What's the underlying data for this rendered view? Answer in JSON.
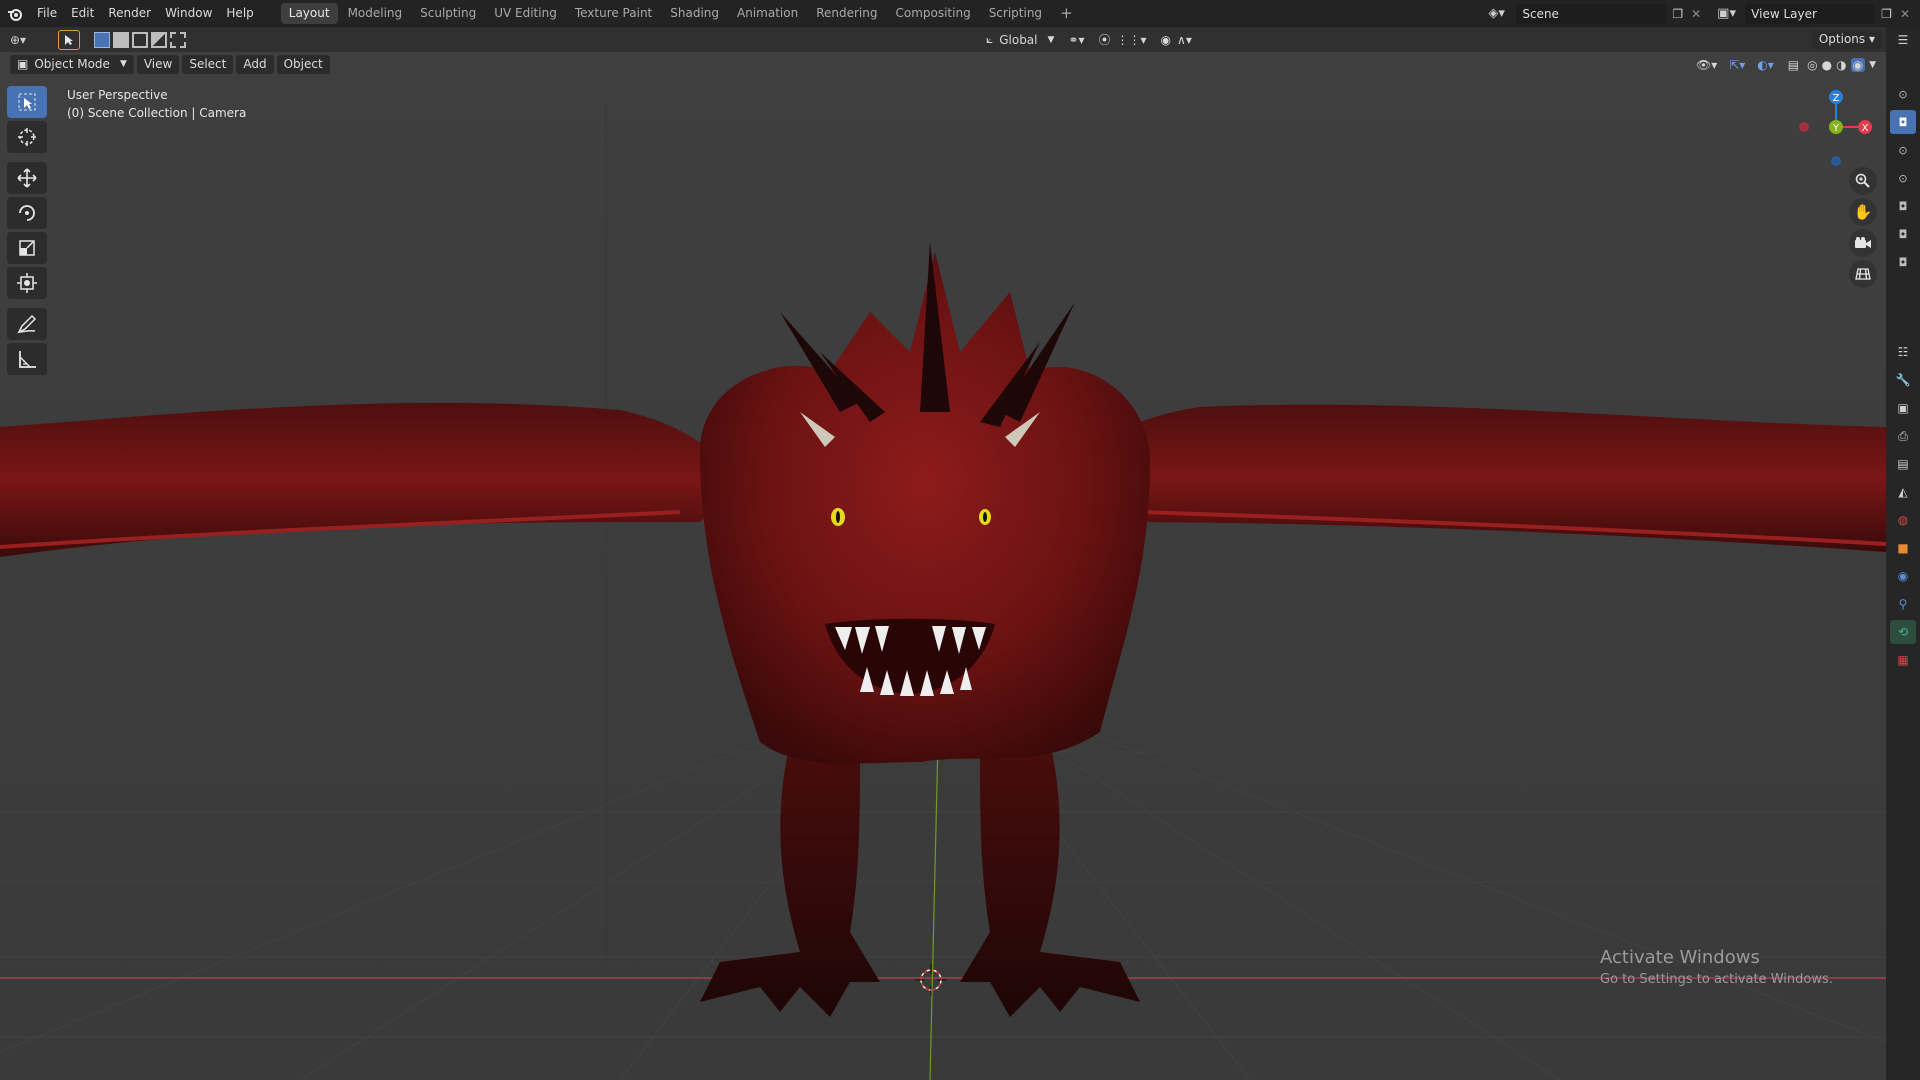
{
  "menu": {
    "file": "File",
    "edit": "Edit",
    "render": "Render",
    "window": "Window",
    "help": "Help"
  },
  "workspaces": [
    "Layout",
    "Modeling",
    "Sculpting",
    "UV Editing",
    "Texture Paint",
    "Shading",
    "Animation",
    "Rendering",
    "Compositing",
    "Scripting"
  ],
  "add_workspace": "+",
  "scene": {
    "label": "Scene"
  },
  "view_layer": {
    "label": "View Layer"
  },
  "header": {
    "transform_orientation": "Global",
    "options": "Options"
  },
  "viewport_menu": {
    "mode": "Object Mode",
    "view": "View",
    "select": "Select",
    "add": "Add",
    "object": "Object"
  },
  "overlay_text": {
    "perspective": "User Perspective",
    "collection": "(0) Scene Collection | Camera"
  },
  "gizmo": {
    "z": "Z",
    "y": "Y",
    "x": "X"
  },
  "watermark": {
    "title": "Activate Windows",
    "subtitle": "Go to Settings to activate Windows."
  },
  "colors": {
    "accent": "#4772b3",
    "x_axis": "#e33b4c",
    "y_axis": "#86b31d",
    "z_axis": "#2b7ed6",
    "dragon": "#7d1616"
  }
}
